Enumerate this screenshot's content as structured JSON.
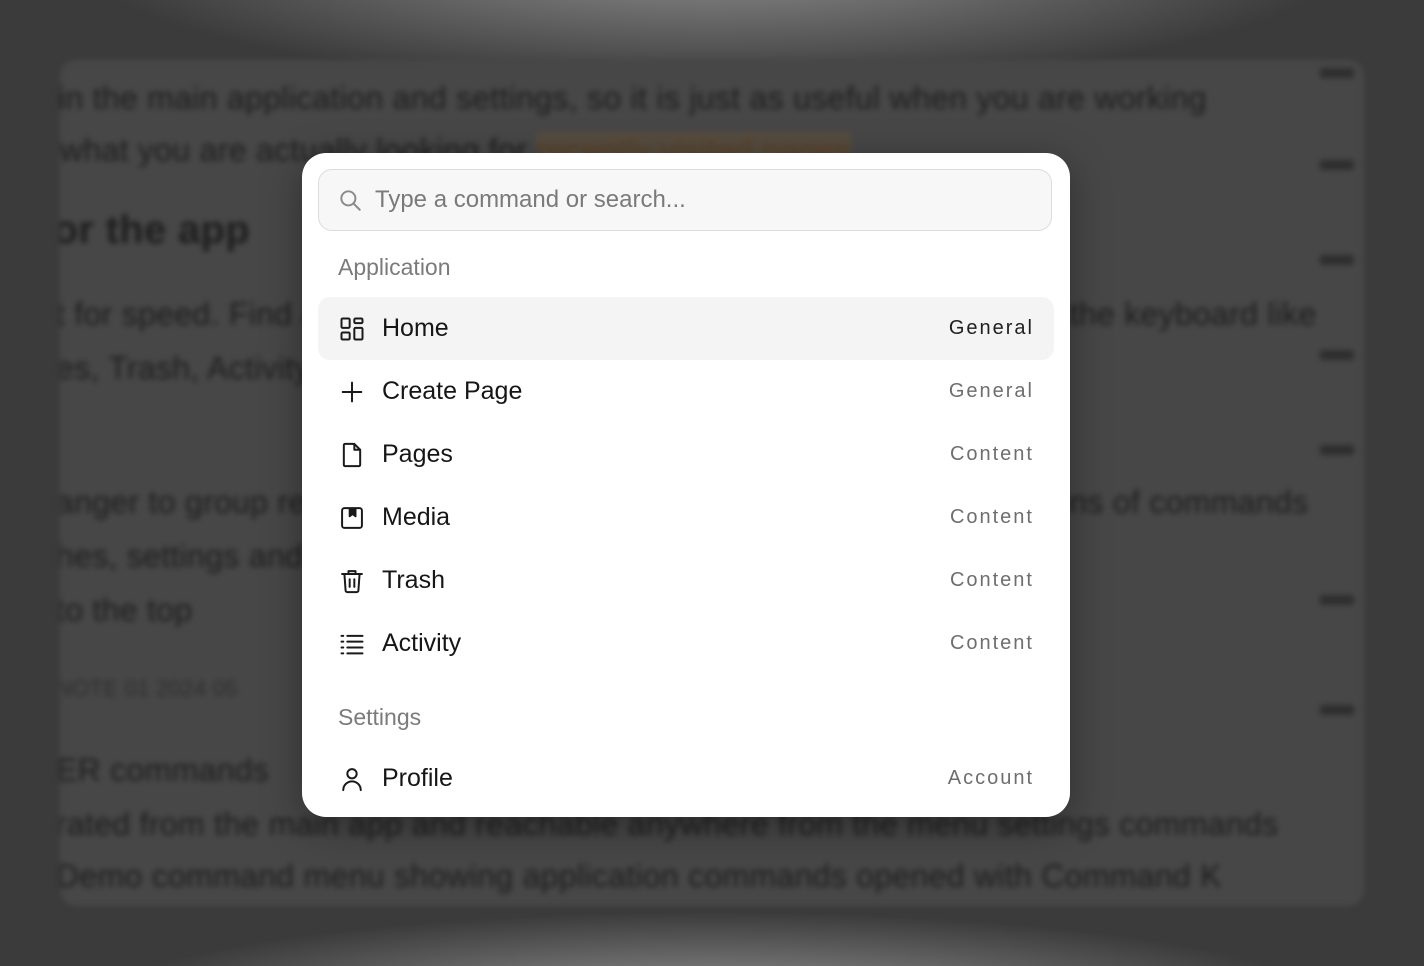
{
  "background": {
    "lines": [
      "in the main application and settings, so it is just as useful when you are working",
      "what you are actually looking for",
      "for the app",
      "t for speed. Find actions and pages by typing, then jump to them from the keyboard like",
      "es, Trash, Activity",
      "anger to group related commands together inside the palette so sections of commands",
      "hes, settings and content each keep their own heading in the menu",
      "to the top",
      "NOTE  01  2024  05",
      "ER   commands",
      "rated from the main app and reachable anywhere from the menu settings commands",
      "Demo command menu showing application commands opened with Command K"
    ],
    "highlight": "recently visited pages"
  },
  "search": {
    "placeholder": "Type a command or search...",
    "value": ""
  },
  "groups": [
    {
      "heading": "Application",
      "items": [
        {
          "label": "Home",
          "tag": "General",
          "icon": "dashboard-icon",
          "active": true
        },
        {
          "label": "Create Page",
          "tag": "General",
          "icon": "plus-icon",
          "active": false
        },
        {
          "label": "Pages",
          "tag": "Content",
          "icon": "file-icon",
          "active": false
        },
        {
          "label": "Media",
          "tag": "Content",
          "icon": "bookmark-box-icon",
          "active": false
        },
        {
          "label": "Trash",
          "tag": "Content",
          "icon": "trash-icon",
          "active": false
        },
        {
          "label": "Activity",
          "tag": "Content",
          "icon": "list-icon",
          "active": false
        }
      ]
    },
    {
      "heading": "Settings",
      "items": [
        {
          "label": "Profile",
          "tag": "Account",
          "icon": "user-icon",
          "active": false
        }
      ]
    }
  ]
}
